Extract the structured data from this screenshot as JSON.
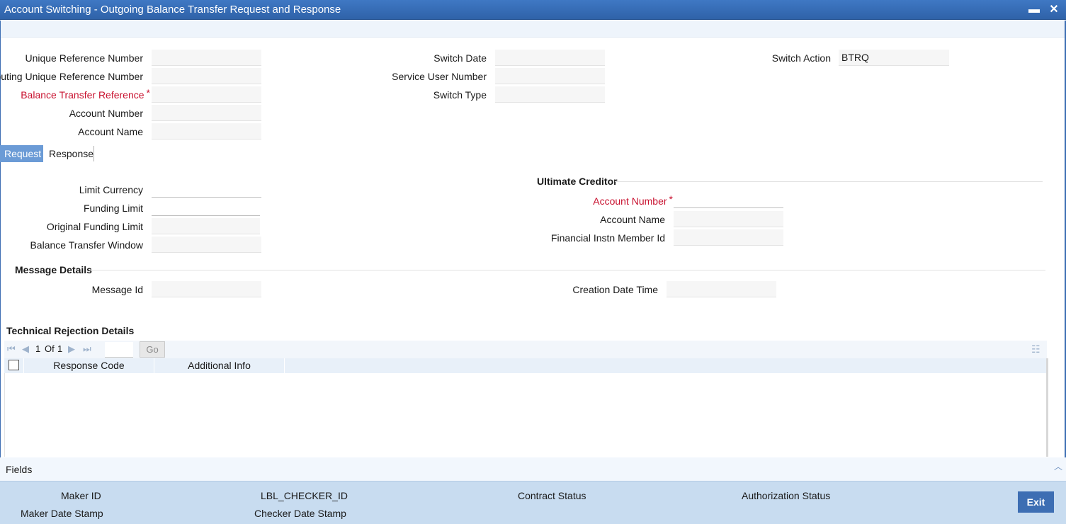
{
  "window": {
    "title": "Account Switching - Outgoing Balance Transfer Request and Response",
    "minimize_glyph": "▬",
    "close_glyph": "✕"
  },
  "header_fields": {
    "unique_reference_number": {
      "label": "Unique Reference Number",
      "value": ""
    },
    "routing_unique_reference_number": {
      "label": "Routing Unique Reference Number",
      "value": ""
    },
    "balance_transfer_reference": {
      "label": "Balance Transfer Reference",
      "value": "",
      "required": "*"
    },
    "account_number": {
      "label": "Account Number",
      "value": ""
    },
    "account_name": {
      "label": "Account Name",
      "value": ""
    },
    "switch_date": {
      "label": "Switch Date",
      "value": ""
    },
    "service_user_number": {
      "label": "Service User Number",
      "value": ""
    },
    "switch_type": {
      "label": "Switch Type",
      "value": ""
    },
    "switch_action": {
      "label": "Switch Action",
      "value": "BTRQ"
    }
  },
  "tabs": [
    {
      "label": "Request",
      "active": true
    },
    {
      "label": "Response",
      "active": false
    }
  ],
  "request": {
    "limit_currency": {
      "label": "Limit Currency",
      "value": ""
    },
    "funding_limit": {
      "label": "Funding Limit",
      "value": ""
    },
    "original_funding_limit": {
      "label": "Original Funding Limit",
      "value": ""
    },
    "balance_transfer_window": {
      "label": "Balance Transfer Window",
      "value": ""
    },
    "ultimate_creditor": {
      "heading": "Ultimate Creditor",
      "account_number": {
        "label": "Account Number",
        "value": "",
        "required": "*"
      },
      "account_name": {
        "label": "Account Name",
        "value": ""
      },
      "financial_instn_member_id": {
        "label": "Financial Instn Member Id",
        "value": ""
      }
    },
    "message_details": {
      "heading": "Message Details",
      "message_id": {
        "label": "Message Id",
        "value": ""
      },
      "creation_date_time": {
        "label": "Creation Date Time",
        "value": ""
      }
    },
    "technical_rejection": {
      "heading": "Technical Rejection Details",
      "pagination": {
        "current": "1",
        "of_label": "Of",
        "total": "1",
        "go_label": "Go",
        "page_input": ""
      },
      "columns": [
        "Response Code",
        "Additional Info"
      ],
      "rows": []
    }
  },
  "fields_bar": {
    "label": "Fields",
    "collapse_glyph": "︿"
  },
  "footer": {
    "maker_id": "Maker ID",
    "maker_date_stamp": "Maker Date Stamp",
    "checker_id": "LBL_CHECKER_ID",
    "checker_date_stamp": "Checker Date Stamp",
    "contract_status": "Contract Status",
    "authorization_status": "Authorization Status",
    "exit_label": "Exit"
  },
  "icons": {
    "first": "first-page-icon",
    "prev": "previous-page-icon",
    "next": "next-page-icon",
    "last": "last-page-icon",
    "settings": "grid-settings-icon"
  },
  "colors": {
    "title_bar": "#2f62a8",
    "active_tab": "#6b9bd6",
    "required": "#c8102e",
    "footer": "#c8dcf0",
    "exit_button": "#3d6eb3"
  }
}
